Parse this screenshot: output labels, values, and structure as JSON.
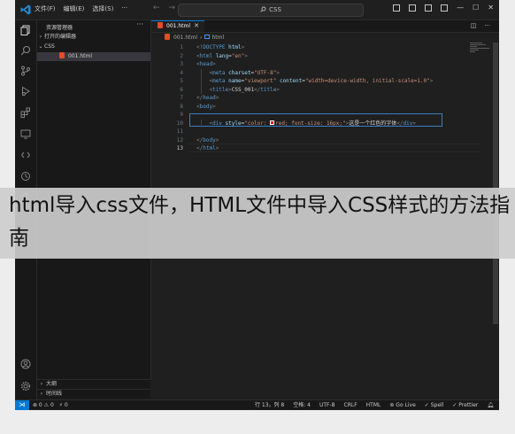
{
  "menu": [
    "文件(F)",
    "编辑(E)",
    "选择(S)",
    "···"
  ],
  "search": {
    "label": "CSS"
  },
  "sidebar": {
    "title": "资源管理器",
    "dots": "···",
    "open_editors": "打开的编辑器",
    "folder": "CSS",
    "file": "001.html",
    "outline": "大纲",
    "timeline": "时间线"
  },
  "tab": {
    "label": "001.html",
    "close": "✕"
  },
  "breadcrumb": {
    "file": "001.html",
    "sep": "›",
    "node": "html"
  },
  "code": [
    {
      "n": "1",
      "parts": [
        [
          "t-punc",
          "<!"
        ],
        [
          "t-tag",
          "DOCTYPE"
        ],
        [
          "t-attr",
          " html"
        ],
        [
          "t-punc",
          ">"
        ]
      ]
    },
    {
      "n": "2",
      "parts": [
        [
          "t-punc",
          "<"
        ],
        [
          "t-tag",
          "html"
        ],
        [
          "t-attr",
          " lang"
        ],
        [
          "t-txt",
          "="
        ],
        [
          "t-str",
          "\"en\""
        ],
        [
          "t-punc",
          ">"
        ]
      ]
    },
    {
      "n": "3",
      "parts": [
        [
          "t-punc",
          "<"
        ],
        [
          "t-tag",
          "head"
        ],
        [
          "t-punc",
          ">"
        ]
      ]
    },
    {
      "n": "4",
      "parts": [
        [
          "t-txt",
          "    "
        ],
        [
          "t-punc",
          "<"
        ],
        [
          "t-tag",
          "meta"
        ],
        [
          "t-attr",
          " charset"
        ],
        [
          "t-txt",
          "="
        ],
        [
          "t-str",
          "\"UTF-8\""
        ],
        [
          "t-punc",
          ">"
        ]
      ]
    },
    {
      "n": "5",
      "parts": [
        [
          "t-txt",
          "    "
        ],
        [
          "t-punc",
          "<"
        ],
        [
          "t-tag",
          "meta"
        ],
        [
          "t-attr",
          " name"
        ],
        [
          "t-txt",
          "="
        ],
        [
          "t-str",
          "\"viewport\""
        ],
        [
          "t-attr",
          " content"
        ],
        [
          "t-txt",
          "="
        ],
        [
          "t-str",
          "\"width=device-width, initial-scale=1.0\""
        ],
        [
          "t-punc",
          ">"
        ]
      ]
    },
    {
      "n": "6",
      "parts": [
        [
          "t-txt",
          "    "
        ],
        [
          "t-punc",
          "<"
        ],
        [
          "t-tag",
          "title"
        ],
        [
          "t-punc",
          ">"
        ],
        [
          "t-txt",
          "CSS_001"
        ],
        [
          "t-punc",
          "</"
        ],
        [
          "t-tag",
          "title"
        ],
        [
          "t-punc",
          ">"
        ]
      ]
    },
    {
      "n": "7",
      "parts": [
        [
          "t-punc",
          "</"
        ],
        [
          "t-tag",
          "head"
        ],
        [
          "t-punc",
          ">"
        ]
      ]
    },
    {
      "n": "8",
      "parts": [
        [
          "t-punc",
          "<"
        ],
        [
          "t-tag",
          "body"
        ],
        [
          "t-punc",
          ">"
        ]
      ]
    },
    {
      "n": "9",
      "parts": []
    },
    {
      "n": "10",
      "parts": [
        [
          "t-txt",
          "    "
        ],
        [
          "t-punc",
          "<"
        ],
        [
          "t-tag",
          "div"
        ],
        [
          "t-attr",
          " style"
        ],
        [
          "t-txt",
          "="
        ],
        [
          "t-str",
          "\"color: "
        ],
        [
          "swatch",
          ""
        ],
        [
          "t-str",
          "red; font-size: 16px;\""
        ],
        [
          "t-punc",
          ">"
        ],
        [
          "t-txt",
          "这是一个红色的字体"
        ],
        [
          "t-punc",
          "</"
        ],
        [
          "t-tag",
          "div"
        ],
        [
          "t-punc",
          ">"
        ]
      ]
    },
    {
      "n": "11",
      "parts": []
    },
    {
      "n": "12",
      "parts": [
        [
          "t-punc",
          "</"
        ],
        [
          "t-tag",
          "body"
        ],
        [
          "t-punc",
          ">"
        ]
      ]
    },
    {
      "n": "13",
      "parts": [
        [
          "t-punc",
          "</"
        ],
        [
          "t-tag",
          "html"
        ],
        [
          "t-punc",
          ">"
        ]
      ]
    }
  ],
  "status": {
    "remote": "⋊",
    "errors": "⊗ 0 ⚠ 0",
    "ports": "⚡ 0",
    "position": "行 13，列 8",
    "spaces": "空格: 4",
    "encoding": "UTF-8",
    "eol": "CRLF",
    "language": "HTML",
    "golive": "Go Live",
    "spell": "✓ Spell",
    "prettier": "✓ Prettier"
  },
  "banner": {
    "title": "html导入css文件，HTML文件中导入CSS样式的方法指南"
  }
}
